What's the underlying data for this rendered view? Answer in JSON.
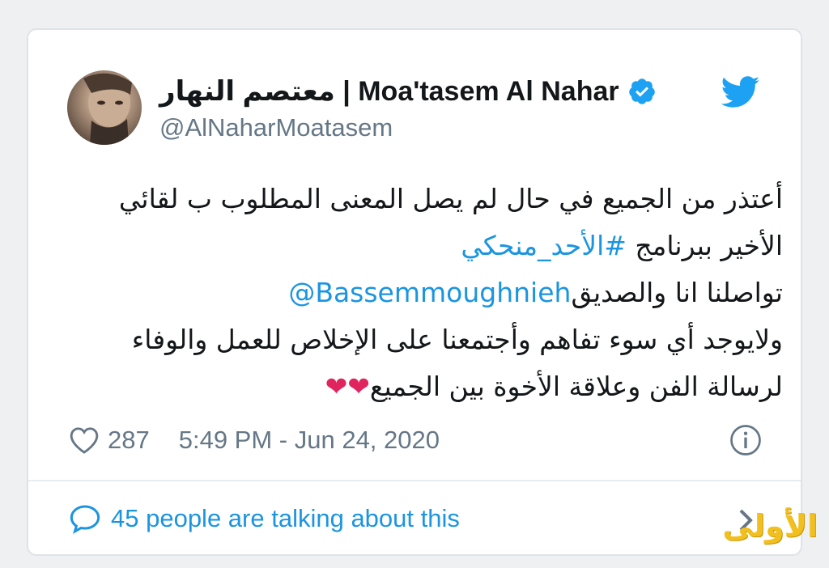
{
  "tweet": {
    "display_name": "معتصم النهار | Moa'tasem Al Nahar",
    "handle": "@AlNaharMoatasem",
    "body": {
      "line1": "أعتذر من الجميع في حال لم يصل المعنى المطلوب ب لقائي",
      "line2_text": "الأخير ببرنامج ",
      "line2_hashtag": "#الأحد_منحكي",
      "line3_text": "تواصلنا انا والصديق",
      "line3_mention": "@Bassemmoughnieh",
      "line4": "ولايوجد أي سوء تفاهم وأجتمعنا على الإخلاص للعمل والوفاء",
      "line5": "لرسالة الفن وعلاقة الأخوة بين الجميع",
      "line5_emoji": "❤❤"
    },
    "likes": "287",
    "timestamp": "5:49 PM - Jun 24, 2020",
    "talking": "45 people are talking about this"
  },
  "watermark": "الأولى",
  "icons": {
    "brand": "twitter-bird-icon",
    "verified": "verified-badge-icon",
    "like": "heart-outline-icon",
    "info": "info-icon",
    "reply": "speech-bubble-icon",
    "chevron": "chevron-right-icon"
  },
  "colors": {
    "link": "#1b95e0",
    "muted": "#657786",
    "text": "#14171a",
    "heart": "#e0245e",
    "watermark": "#f2c01e"
  }
}
